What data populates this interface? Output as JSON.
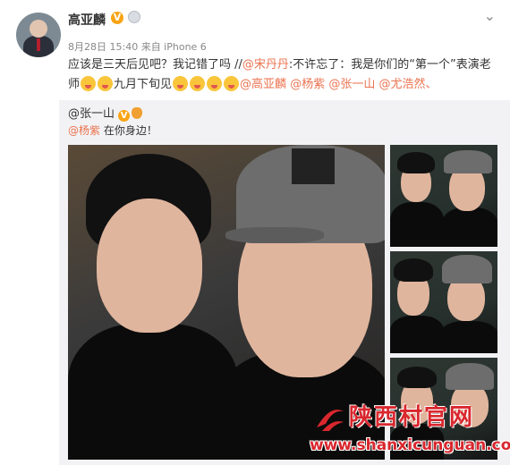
{
  "post": {
    "username": "高亚麟",
    "verified_badge": "V",
    "meta": "8月28日 15:40 来自 iPhone 6",
    "text_part1": "应该是三天后见吧？我记错了吗 //",
    "mention_song": "@宋丹丹",
    "text_part2": ":不许忘了：我是你们的“第一个”表演老师",
    "text_part3": "九月下旬见",
    "mention_gao": "@高亚麟",
    "mention_yang": "@杨紫",
    "mention_zhang": "@张一山",
    "mention_you": "@尤浩然",
    "text_end": "、"
  },
  "repost": {
    "author": "@张一山",
    "verified_badge": "V",
    "mention": "@杨紫",
    "text": "在你身边！"
  },
  "watermark": {
    "title": "陕西村官网",
    "url": "www.shanxicunguan.com",
    "color": "#d9272e"
  },
  "icons": {
    "menu": "chevron-down-icon",
    "emoji": "laughing-emoji-icon"
  },
  "colors": {
    "mention": "#eb7350",
    "badge": "#f8a414",
    "repost_bg": "#f2f2f5"
  }
}
